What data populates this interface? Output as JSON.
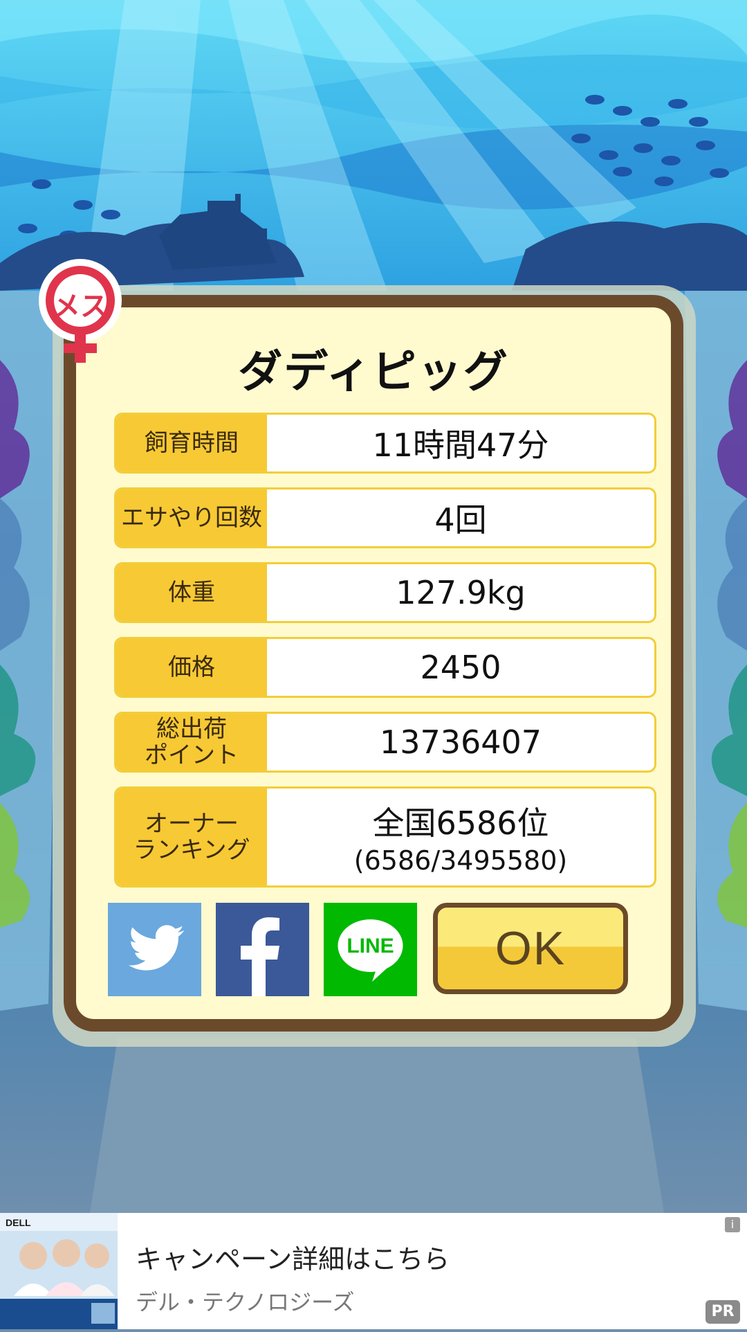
{
  "dialog": {
    "title": "ダディピッグ",
    "gender_badge": "メス",
    "rows": [
      {
        "label": "飼育時間",
        "value": "11時間47分"
      },
      {
        "label": "エサやり回数",
        "value": "4回"
      },
      {
        "label": "体重",
        "value": "127.9kg"
      },
      {
        "label": "価格",
        "value": "2450"
      },
      {
        "label": "総出荷\nポイント",
        "value": "13736407"
      },
      {
        "label": "オーナー\nランキング",
        "value": "全国6586位",
        "value_sub": "(6586/3495580)"
      }
    ],
    "share": {
      "twitter_icon": "twitter-bird-icon",
      "facebook_icon": "facebook-f-icon",
      "line_label": "LINE"
    },
    "ok_label": "OK"
  },
  "ad": {
    "title": "キャンペーン詳細はこちら",
    "advertiser": "デル・テクノロジーズ",
    "info_label": "i",
    "pr_label": "PR",
    "brand_label": "DELL"
  },
  "colors": {
    "frame_brown": "#6b4a2b",
    "panel_cream": "#fffbcf",
    "label_yellow": "#f7c934",
    "twitter_blue": "#6aa8de",
    "facebook_blue": "#3b5998",
    "line_green": "#00b900",
    "badge_red": "#e0344c"
  }
}
